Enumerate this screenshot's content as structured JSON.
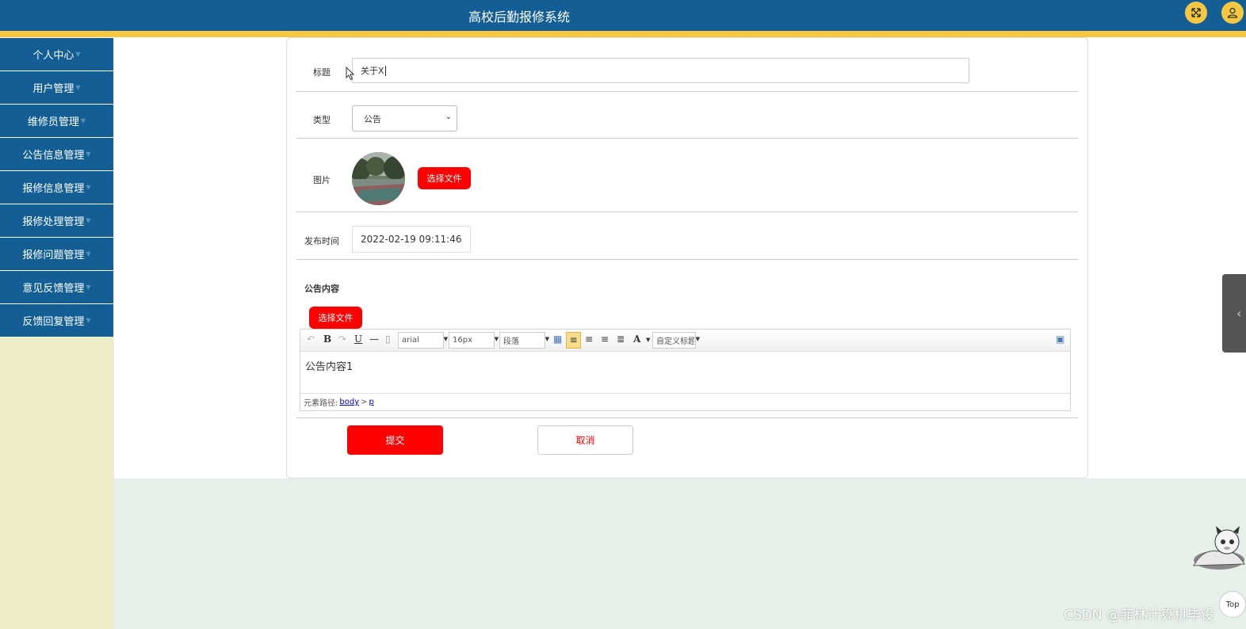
{
  "header": {
    "title": "高校后勤报修系统"
  },
  "sidebar": {
    "items": [
      {
        "label": "个人中心"
      },
      {
        "label": "用户管理"
      },
      {
        "label": "维修员管理"
      },
      {
        "label": "公告信息管理"
      },
      {
        "label": "报修信息管理"
      },
      {
        "label": "报修处理管理"
      },
      {
        "label": "报修问题管理"
      },
      {
        "label": "意见反馈管理"
      },
      {
        "label": "反馈回复管理"
      }
    ],
    "caret": "▼"
  },
  "form": {
    "title_label": "标题",
    "title_value": "关于X",
    "type_label": "类型",
    "type_value": "公告",
    "image_label": "图片",
    "choose_file": "选择文件",
    "date_label": "发布时间",
    "date_value": "2022-02-19 09:11:46",
    "content_label": "公告内容",
    "content_choose_file": "选择文件",
    "submit": "提交",
    "cancel": "取消"
  },
  "editor": {
    "font_family": "arial",
    "font_size": "16px",
    "paragraph": "段落",
    "custom_title": "自定义标题",
    "content": "公告内容1",
    "path_label": "元素路径:",
    "path_body": "body",
    "path_sep": ">",
    "path_p": "p"
  },
  "footer": {
    "watermark": "CSDN @菲林计算机毕设",
    "top_button": "Top"
  },
  "colors": {
    "primary": "#135f95",
    "accent_yellow": "#f6c842",
    "danger": "#ff0000",
    "sidebar_bg": "#ecedc8"
  }
}
